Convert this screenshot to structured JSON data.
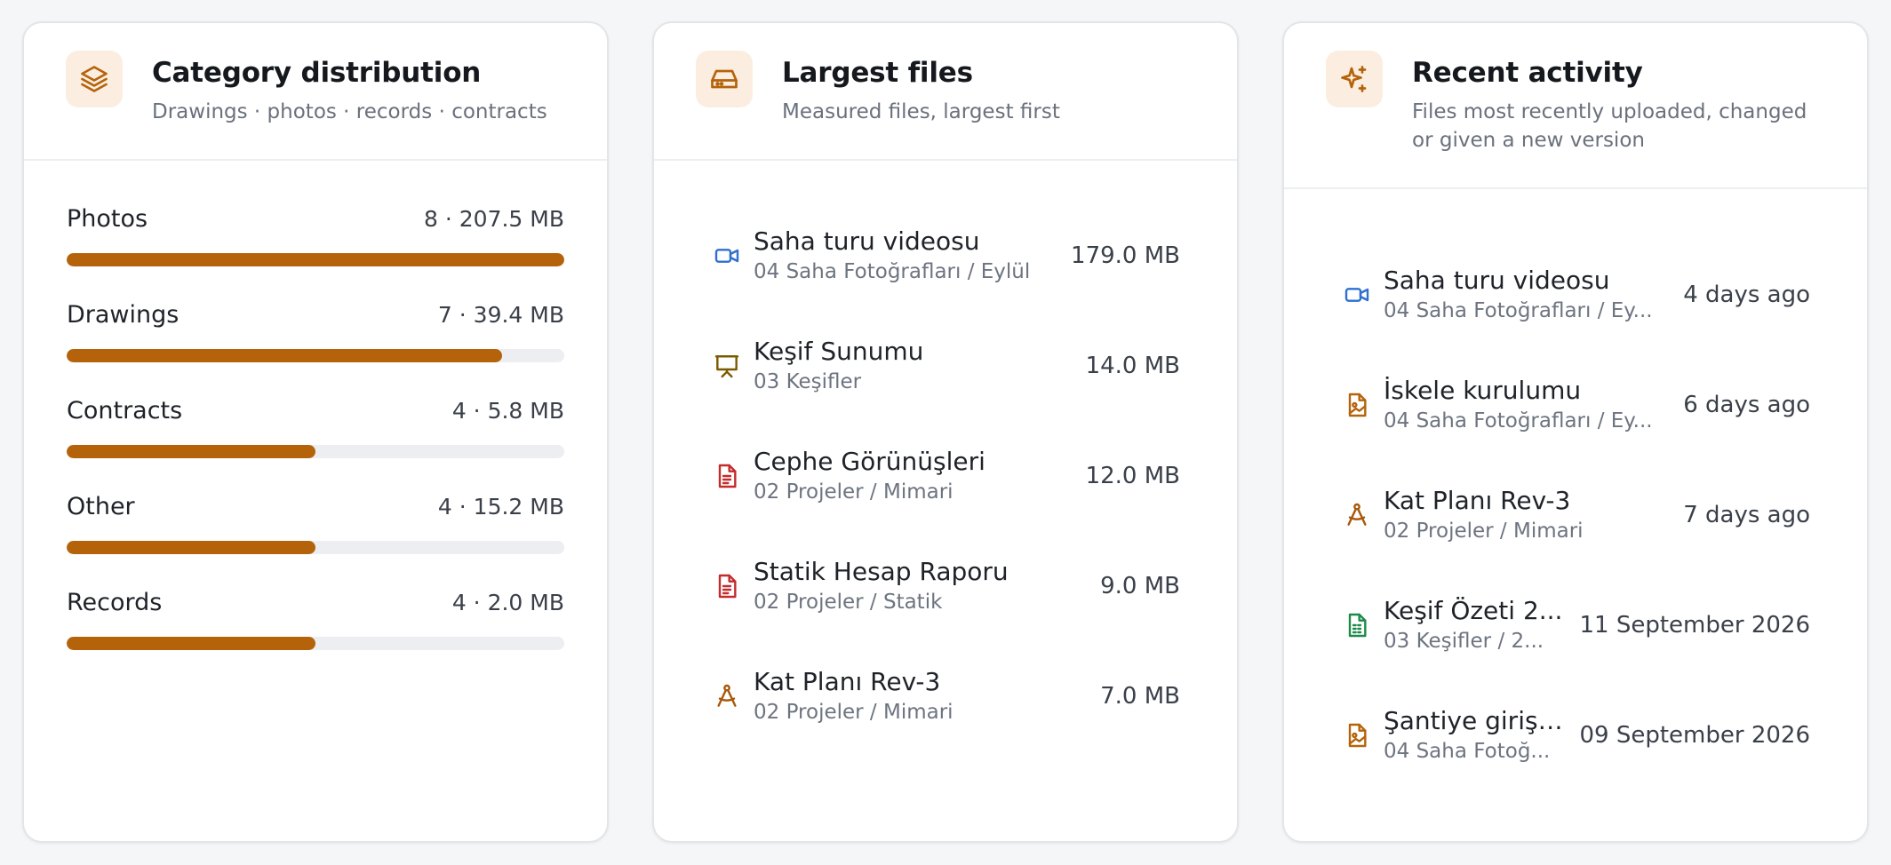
{
  "category_card": {
    "title": "Category distribution",
    "subtitle": "Drawings · photos · records · contracts",
    "icon": "layers-icon",
    "bar_color": "#b5630b",
    "items": [
      {
        "label": "Photos",
        "value": "8 · 207.5 MB",
        "fill_pct": 100
      },
      {
        "label": "Drawings",
        "value": "7 · 39.4 MB",
        "fill_pct": 87.5
      },
      {
        "label": "Contracts",
        "value": "4 · 5.8 MB",
        "fill_pct": 50
      },
      {
        "label": "Other",
        "value": "4 · 15.2 MB",
        "fill_pct": 50
      },
      {
        "label": "Records",
        "value": "4 · 2.0 MB",
        "fill_pct": 50
      }
    ]
  },
  "largest_card": {
    "title": "Largest files",
    "subtitle": "Measured files, largest first",
    "icon": "hard-drive-icon",
    "items": [
      {
        "icon": "video-icon",
        "name": "Saha turu videosu",
        "path": "04 Saha Fotoğrafları / Eylül",
        "size": "179.0 MB"
      },
      {
        "icon": "presentation-icon",
        "name": "Keşif Sunumu",
        "path": "03 Keşifler",
        "size": "14.0 MB"
      },
      {
        "icon": "pdf-file-icon",
        "name": "Cephe Görünüşleri",
        "path": "02 Projeler / Mimari",
        "size": "12.0 MB"
      },
      {
        "icon": "pdf-file-icon",
        "name": "Statik Hesap Raporu",
        "path": "02 Projeler / Statik",
        "size": "9.0 MB"
      },
      {
        "icon": "drafting-compass-icon",
        "name": "Kat Planı Rev-3",
        "path": "02 Projeler / Mimari",
        "size": "7.0 MB"
      }
    ]
  },
  "activity_card": {
    "title": "Recent activity",
    "subtitle": "Files most recently uploaded, changed or given a new version",
    "icon": "sparkles-icon",
    "items": [
      {
        "icon": "video-icon",
        "name": "Saha turu videosu",
        "path": "04 Saha Fotoğrafları / Ey...",
        "when": "4 days ago"
      },
      {
        "icon": "image-file-icon",
        "name": "İskele kurulumu",
        "path": "04 Saha Fotoğrafları / Ey...",
        "when": "6 days ago"
      },
      {
        "icon": "drafting-compass-icon",
        "name": "Kat Planı Rev-3",
        "path": "02 Projeler / Mimari",
        "when": "7 days ago"
      },
      {
        "icon": "spreadsheet-file-icon",
        "name": "Keşif Özeti 2...",
        "path": "03 Keşifler / 2...",
        "when": "11 September 2026"
      },
      {
        "icon": "image-file-icon",
        "name": "Şantiye giriş ...",
        "path": "04 Saha Fotoğ...",
        "when": "09 September 2026"
      }
    ]
  },
  "colors": {
    "accent": "#b5630b",
    "icon_bg": "#fbeee1",
    "video": "#2f6fd0",
    "pdf": "#c42b2b",
    "presentation": "#7a5a00",
    "drawing": "#a8580a",
    "spreadsheet": "#1e8a4a",
    "image": "#b5630b"
  }
}
